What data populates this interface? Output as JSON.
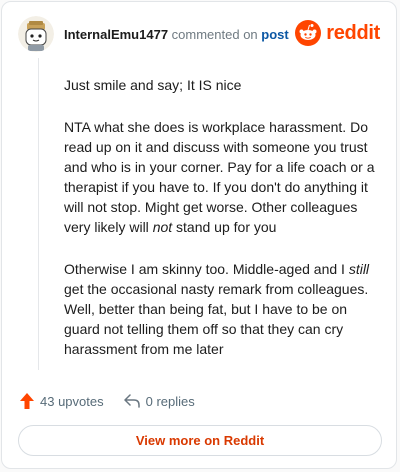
{
  "comment": {
    "author": "InternalEmu1477",
    "action_text": "commented on",
    "post_link": "post",
    "paragraphs": [
      "Just smile and say; It IS nice",
      {
        "before": "NTA what she does is workplace harassment. Do read up on it and discuss with someone you trust and who is in your corner. Pay for a life coach or a therapist if you have to. If you don't do anything it will not stop. Might get worse. Other colleagues very likely will ",
        "emphasis": "not",
        "after": " stand up for you"
      },
      {
        "before": "Otherwise I am skinny too. Middle-aged and I ",
        "emphasis": "still",
        "after": " get the occasional nasty remark from colleagues. Well, better than being fat, but I have to be on guard not telling them off so that they can cry harassment from me later"
      }
    ]
  },
  "brand": {
    "name": "reddit",
    "color": "#ff4500"
  },
  "actions": {
    "upvotes": "43 upvotes",
    "replies": "0 replies"
  },
  "footer": {
    "view_more": "View more on Reddit"
  },
  "icons": {
    "avatar": "snoo-avatar-icon",
    "logo": "reddit-logo-icon",
    "upvote": "upvote-arrow-icon",
    "reply": "reply-arrow-icon"
  }
}
